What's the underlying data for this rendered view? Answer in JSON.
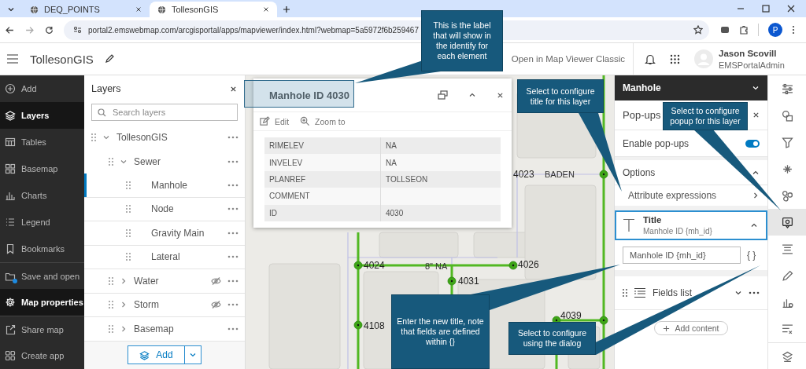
{
  "browser": {
    "tabs": [
      {
        "label": "DEQ_POINTS",
        "selected": false
      },
      {
        "label": "TollesonGIS",
        "selected": true
      }
    ],
    "url": "portal2.emswebmap.com/arcgisportal/apps/mapviewer/index.html?webmap=5a5972f6b259467",
    "profile_initial": "P"
  },
  "app_header": {
    "title": "TollesonGIS",
    "classic_link": "Open in Map Viewer Classic",
    "user_name": "Jason Scovill",
    "user_role": "EMSPortalAdmin"
  },
  "nav": [
    {
      "label": "Add",
      "selected": false,
      "badge": false
    },
    {
      "label": "Layers",
      "selected": true,
      "badge": false
    },
    {
      "label": "Tables",
      "selected": false,
      "badge": false
    },
    {
      "label": "Basemap",
      "selected": false,
      "badge": false
    },
    {
      "label": "Charts",
      "selected": false,
      "badge": false
    },
    {
      "label": "Legend",
      "selected": false,
      "badge": false
    },
    {
      "label": "Bookmarks",
      "selected": false,
      "badge": false
    },
    {
      "label": "Save and open",
      "selected": false,
      "badge": true
    },
    {
      "label": "Map properties",
      "selected": true,
      "badge": false
    },
    {
      "label": "Share map",
      "selected": false,
      "badge": false
    },
    {
      "label": "Create app",
      "selected": false,
      "badge": false
    }
  ],
  "layers_panel": {
    "title": "Layers",
    "search": {
      "placeholder": "Search layers"
    },
    "add_button": "Add",
    "tree": [
      {
        "label": "TollesonGIS",
        "selected": false,
        "visible": true,
        "expanded": true,
        "children": [
          {
            "label": "Sewer",
            "selected": false,
            "visible": true,
            "expanded": true,
            "children": [
              {
                "label": "Manhole",
                "selected": true,
                "visible": true
              },
              {
                "label": "Node",
                "selected": false,
                "visible": true
              },
              {
                "label": "Gravity Main",
                "selected": false,
                "visible": true
              },
              {
                "label": "Lateral",
                "selected": false,
                "visible": true
              }
            ]
          },
          {
            "label": "Water",
            "selected": false,
            "visible": false,
            "expanded": false
          },
          {
            "label": "Storm",
            "selected": false,
            "visible": false,
            "expanded": false
          },
          {
            "label": "Basemap",
            "selected": false,
            "visible": true,
            "expanded": false
          }
        ]
      }
    ]
  },
  "map": {
    "labels": [
      {
        "text": "4023"
      },
      {
        "text": "BADEN"
      },
      {
        "text": "4024"
      },
      {
        "text": "8\" NA"
      },
      {
        "text": "4026"
      },
      {
        "text": "4031"
      },
      {
        "text": "4108"
      },
      {
        "text": "4039"
      }
    ],
    "popup": {
      "title": "Manhole ID 4030",
      "actions": [
        "Edit",
        "Zoom to"
      ],
      "fields": [
        {
          "name": "RIMELEV",
          "value": "NA"
        },
        {
          "name": "INVELEV",
          "value": "NA"
        },
        {
          "name": "PLANREF",
          "value": "TOLLSEON"
        },
        {
          "name": "COMMENT"
        },
        {
          "name": "ID",
          "value": "4030"
        }
      ]
    }
  },
  "popup_config": {
    "layer": "Manhole",
    "title": "Pop-ups",
    "enable_popups": {
      "label": "Enable pop-ups",
      "on": true
    },
    "options": {
      "label": "Options",
      "expanded": true,
      "items": [
        "Attribute expressions"
      ]
    },
    "title_element": {
      "label": "Title",
      "subtitle": "Manhole ID {mh_id}",
      "selected": true,
      "expanded": true
    },
    "title_input": {
      "value": "Manhole ID {mh_id}"
    },
    "expression_button": "{ }",
    "fields_list": {
      "label": "Fields list",
      "expanded": false
    },
    "add_content": "Add content"
  },
  "tools": [
    {
      "selected": false
    },
    {
      "selected": false
    },
    {
      "selected": false
    },
    {
      "selected": false
    },
    {
      "selected": false
    },
    {
      "selected": true
    },
    {
      "selected": false
    },
    {
      "selected": false
    },
    {
      "selected": false
    },
    {
      "selected": false
    },
    {
      "selected": false
    }
  ],
  "callouts": [
    {
      "text": "This is the label that will show in the identify for each element"
    },
    {
      "text": "Select to configure title for this layer"
    },
    {
      "text": "Select to configure popup for this layer"
    },
    {
      "text": "Enter the new title, note that fields are defined within {}"
    },
    {
      "text": "Select to configure using the dialog"
    }
  ]
}
